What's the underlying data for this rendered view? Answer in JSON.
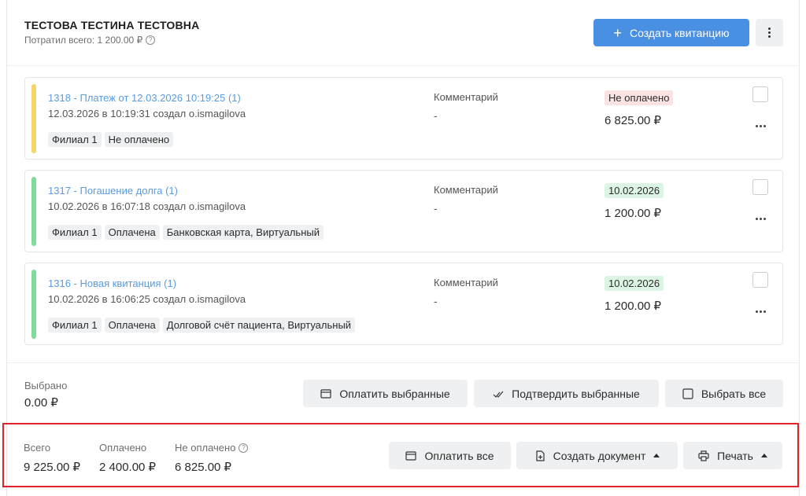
{
  "header": {
    "patient_name": "ТЕСТОВА ТЕСТИНА ТЕСТОВНА",
    "spent_label": "Потратил всего: 1 200.00 ₽",
    "create_button": "Создать квитанцию"
  },
  "cards": [
    {
      "title": "1318 - Платеж от 12.03.2026 10:19:25 (1)",
      "subtitle": "12.03.2026 в 10:19:31 создал o.ismagilova",
      "chips": [
        "Филиал 1",
        "Не оплачено"
      ],
      "comment_label": "Комментарий",
      "comment_value": "-",
      "status": "Не оплачено",
      "status_type": "unpaid",
      "amount": "6 825.00 ₽",
      "bar_color": "#f5d66b"
    },
    {
      "title": "1317 - Погашение долга (1)",
      "subtitle": "10.02.2026 в 16:07:18 создал o.ismagilova",
      "chips": [
        "Филиал 1",
        "Оплачена",
        "Банковская карта, Виртуальный"
      ],
      "comment_label": "Комментарий",
      "comment_value": "-",
      "status": "10.02.2026",
      "status_type": "paid",
      "amount": "1 200.00 ₽",
      "bar_color": "#7fdc9b"
    },
    {
      "title": "1316 - Новая квитанция (1)",
      "subtitle": "10.02.2026 в 16:06:25 создал o.ismagilova",
      "chips": [
        "Филиал 1",
        "Оплачена",
        "Долговой счёт пациента, Виртуальный"
      ],
      "comment_label": "Комментарий",
      "comment_value": "-",
      "status": "10.02.2026",
      "status_type": "paid",
      "amount": "1 200.00 ₽",
      "bar_color": "#7fdc9b"
    }
  ],
  "selected": {
    "label": "Выбрано",
    "value": "0.00 ₽",
    "pay_selected": "Оплатить выбранные",
    "confirm_selected": "Подтвердить выбранные",
    "select_all": "Выбрать все"
  },
  "totals": {
    "total_label": "Всего",
    "total_value": "9 225.00 ₽",
    "paid_label": "Оплачено",
    "paid_value": "2 400.00 ₽",
    "unpaid_label": "Не оплачено",
    "unpaid_value": "6 825.00 ₽",
    "pay_all": "Оплатить все",
    "create_document": "Создать документ",
    "print": "Печать"
  },
  "colors": {
    "accent": "#4a90e2",
    "highlight_frame": "#e0232b"
  }
}
